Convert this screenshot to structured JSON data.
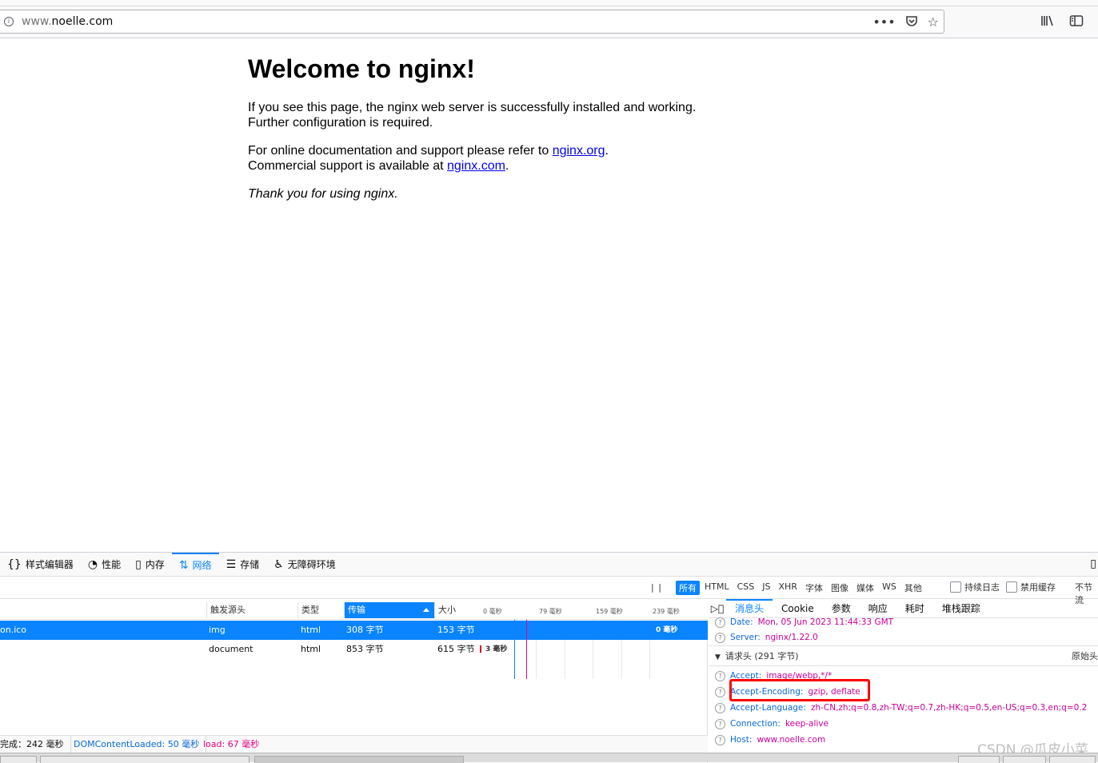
{
  "browser": {
    "url_prefix": "www.",
    "url_domain": "noelle.com",
    "info_icon": "info-icon",
    "page_actions": [
      "more-icon",
      "pocket-icon",
      "bookmark-star-icon"
    ],
    "toolbar_icons": [
      "library-icon",
      "sidebar-icon"
    ]
  },
  "page": {
    "title": "Welcome to nginx!",
    "p1_line1": "If you see this page, the nginx web server is successfully installed and working.",
    "p1_line2": "Further configuration is required.",
    "p2_prefix": "For online documentation and support please refer to",
    "p2_link": "nginx.org",
    "p2_suffix": ".",
    "p3_prefix": "Commercial support is available at",
    "p3_link": "nginx.com",
    "p3_suffix": ".",
    "thanks": "Thank you for using nginx."
  },
  "devtools": {
    "tabs": [
      {
        "label": "样式编辑器",
        "icon": "{}"
      },
      {
        "label": "性能",
        "icon": "◔"
      },
      {
        "label": "内存",
        "icon": "▯"
      },
      {
        "label": "网络",
        "icon": "⇅",
        "active": true
      },
      {
        "label": "存储",
        "icon": "☰"
      },
      {
        "label": "无障碍环境",
        "icon": "♿"
      }
    ],
    "pause": "| |",
    "filters": [
      "所有",
      "HTML",
      "CSS",
      "JS",
      "XHR",
      "字体",
      "图像",
      "媒体",
      "WS",
      "其他"
    ],
    "persist_log": "持续日志",
    "disable_cache": "禁用缓存",
    "throttle": "不节流",
    "columns": {
      "cause": "触发源头",
      "type": "类型",
      "transferred": "传输",
      "size": "大小"
    },
    "waterfall_ticks": [
      "0 毫秒",
      "79 毫秒",
      "159 毫秒",
      "239 毫秒"
    ],
    "requests": [
      {
        "file": "on.ico",
        "cause": "img",
        "type": "html",
        "transferred": "308 字节",
        "size": "153 字节",
        "timing": "0 毫秒"
      },
      {
        "file": "",
        "cause": "document",
        "type": "html",
        "transferred": "853 字节",
        "size": "615 字节",
        "timing": "3 毫秒"
      }
    ],
    "summary": {
      "finish": "完成：242 毫秒",
      "dcl": "DOMContentLoaded: 50 毫秒",
      "load": "load: 67 毫秒"
    },
    "side_tabs": [
      "消息头",
      "Cookie",
      "参数",
      "响应",
      "耗时",
      "堆栈跟踪"
    ],
    "response_headers": [
      {
        "name": "Date:",
        "value": "Mon, 05 Jun 2023 11:44:33 GMT"
      },
      {
        "name": "Server:",
        "value": "nginx/1.22.0"
      }
    ],
    "request_section": "请求头 (291 字节)",
    "raw_headers": "原始头",
    "request_headers": [
      {
        "name": "Accept:",
        "value": "image/webp,*/*"
      },
      {
        "name": "Accept-Encoding:",
        "value": "gzip, deflate"
      },
      {
        "name": "Accept-Language:",
        "value": "zh-CN,zh;q=0.8,zh-TW;q=0.7,zh-HK;q=0.5,en-US;q=0.3,en;q=0.2"
      },
      {
        "name": "Connection:",
        "value": "keep-alive"
      },
      {
        "name": "Host:",
        "value": "www.noelle.com"
      }
    ]
  },
  "watermark": "CSDN @瓜皮小菜"
}
